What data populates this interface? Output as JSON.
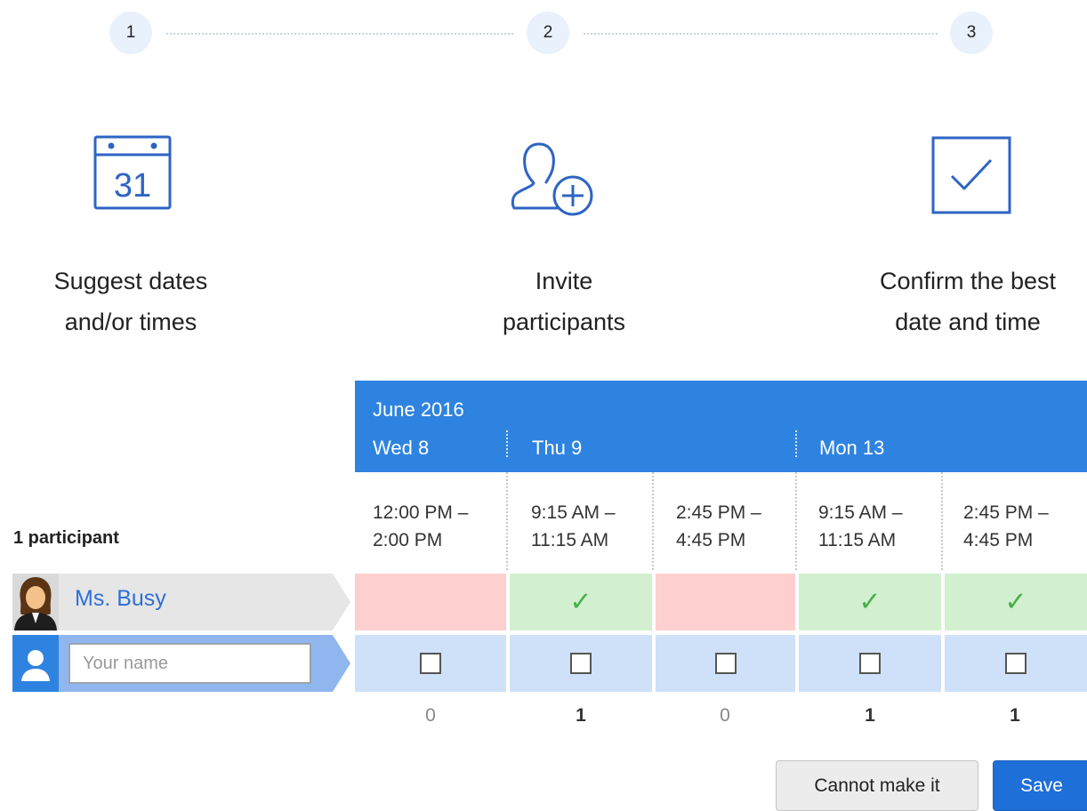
{
  "stepper": {
    "steps": [
      {
        "number": "1"
      },
      {
        "number": "2"
      },
      {
        "number": "3"
      }
    ]
  },
  "steps": [
    {
      "icon": "calendar-icon",
      "icon_text": "31",
      "label": "Suggest dates\nand/or times"
    },
    {
      "icon": "add-user-icon",
      "label": "Invite\nparticipants"
    },
    {
      "icon": "checkbox-checked-icon",
      "label": "Confirm the best\ndate and time"
    }
  ],
  "poll": {
    "month": "June 2016",
    "days": [
      "Wed 8",
      "Thu 9",
      "Mon 13"
    ],
    "times": [
      "12:00 PM –\n2:00 PM",
      "9:15 AM –\n11:15 AM",
      "2:45 PM –\n4:45 PM",
      "9:15 AM –\n11:15 AM",
      "2:45 PM –\n4:45 PM"
    ],
    "participant_count": "1 participant",
    "participants": [
      {
        "name": "Ms. Busy",
        "responses": [
          "no",
          "yes",
          "no",
          "yes",
          "yes"
        ]
      }
    ],
    "name_input": {
      "placeholder": "Your name",
      "value": ""
    },
    "totals": [
      "0",
      "1",
      "0",
      "1",
      "1"
    ]
  },
  "buttons": {
    "cannot_make_it": "Cannot make it",
    "save": "Save"
  },
  "colors": {
    "header_blue": "#2f83e0",
    "no_red": "#fdcfcf",
    "yes_green": "#d2f0cf",
    "input_blue": "#cfe1f8",
    "link_blue": "#2f6fd6",
    "save_blue": "#1f6fd8"
  }
}
